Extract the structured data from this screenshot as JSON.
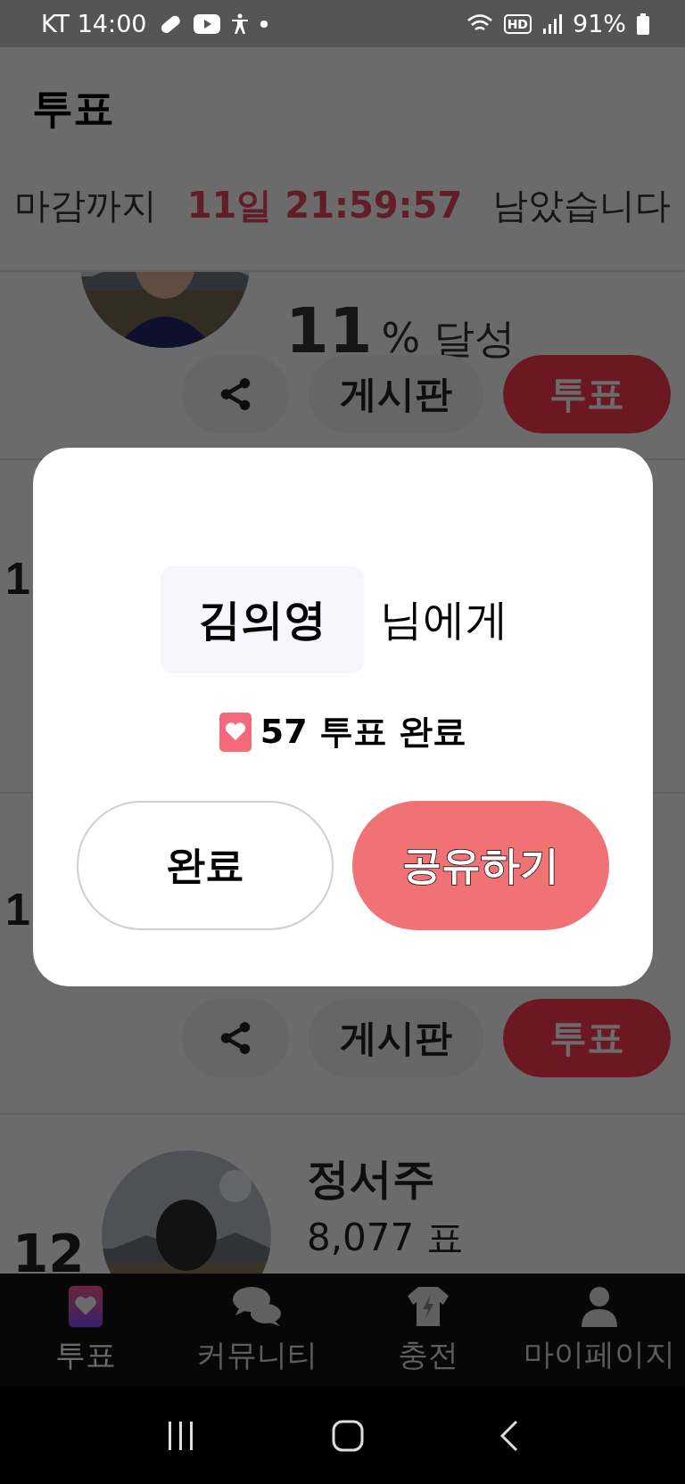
{
  "status_bar": {
    "carrier_time": "KT 14:00",
    "hd_badge": "HD",
    "battery": "91%"
  },
  "header": {
    "title": "투표",
    "countdown_prefix": "마감까지",
    "countdown_time": "11일 21:59:57",
    "countdown_suffix": "남았습니다"
  },
  "top_card": {
    "percent": "11",
    "percent_unit": "% 달성",
    "board_button": "게시판",
    "vote_button": "투표"
  },
  "hidden_ranks": [
    "1",
    "1"
  ],
  "middle_actions": {
    "board_button": "게시판",
    "vote_button": "투표"
  },
  "bottom_card": {
    "rank": "12",
    "name": "정서주",
    "votes": "8,077 표"
  },
  "dialog": {
    "name": "김의영",
    "name_suffix": "님에게",
    "result": "57 투표 완료",
    "buttons": [
      {
        "label": "완료",
        "kind": "secondary"
      },
      {
        "label": "공유하기",
        "kind": "primary"
      }
    ]
  },
  "bottom_nav": [
    {
      "label": "투표",
      "kind": "vote",
      "selected": true
    },
    {
      "label": "커뮤니티",
      "kind": "community",
      "selected": false
    },
    {
      "label": "충전",
      "kind": "charge",
      "selected": false
    },
    {
      "label": "마이페이지",
      "kind": "mypage",
      "selected": false
    }
  ]
}
